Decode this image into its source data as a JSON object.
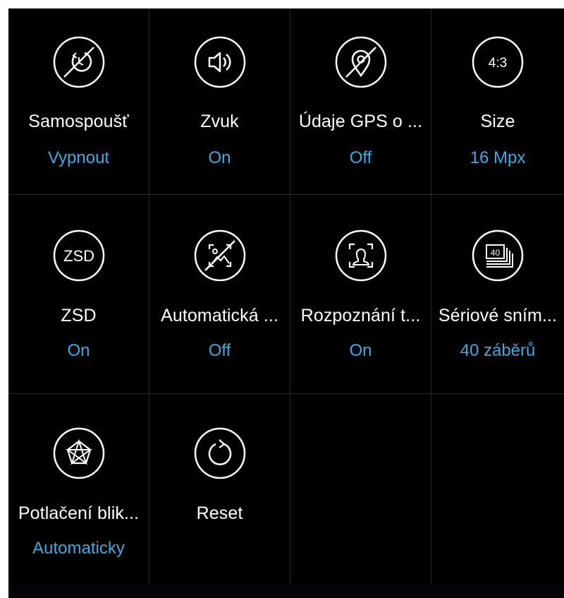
{
  "settings": [
    {
      "label": "Samospoušť",
      "value": "Vypnout",
      "icon": "timer-off-icon"
    },
    {
      "label": "Zvuk",
      "value": "On",
      "icon": "sound-icon"
    },
    {
      "label": "Údaje GPS o ...",
      "value": "Off",
      "icon": "gps-off-icon"
    },
    {
      "label": "Size",
      "value": "16 Mpx",
      "icon": "aspect-ratio-icon",
      "icon_text": "4:3"
    },
    {
      "label": "ZSD",
      "value": "On",
      "icon": "zsd-icon",
      "icon_text": "ZSD"
    },
    {
      "label": "Automatická ...",
      "value": "Off",
      "icon": "auto-scene-off-icon"
    },
    {
      "label": "Rozpoznání t...",
      "value": "On",
      "icon": "face-detection-icon"
    },
    {
      "label": "Sériové sním...",
      "value": "40 záběrů",
      "icon": "burst-shot-icon",
      "icon_text": "40"
    },
    {
      "label": "Potlačení blik...",
      "value": "Automaticky",
      "icon": "anti-flicker-icon"
    },
    {
      "label": "Reset",
      "value": "",
      "icon": "reset-icon"
    }
  ],
  "colors": {
    "background": "#000000",
    "label": "#ffffff",
    "value": "#3fa9e0",
    "divider": "#2a2a2a"
  }
}
